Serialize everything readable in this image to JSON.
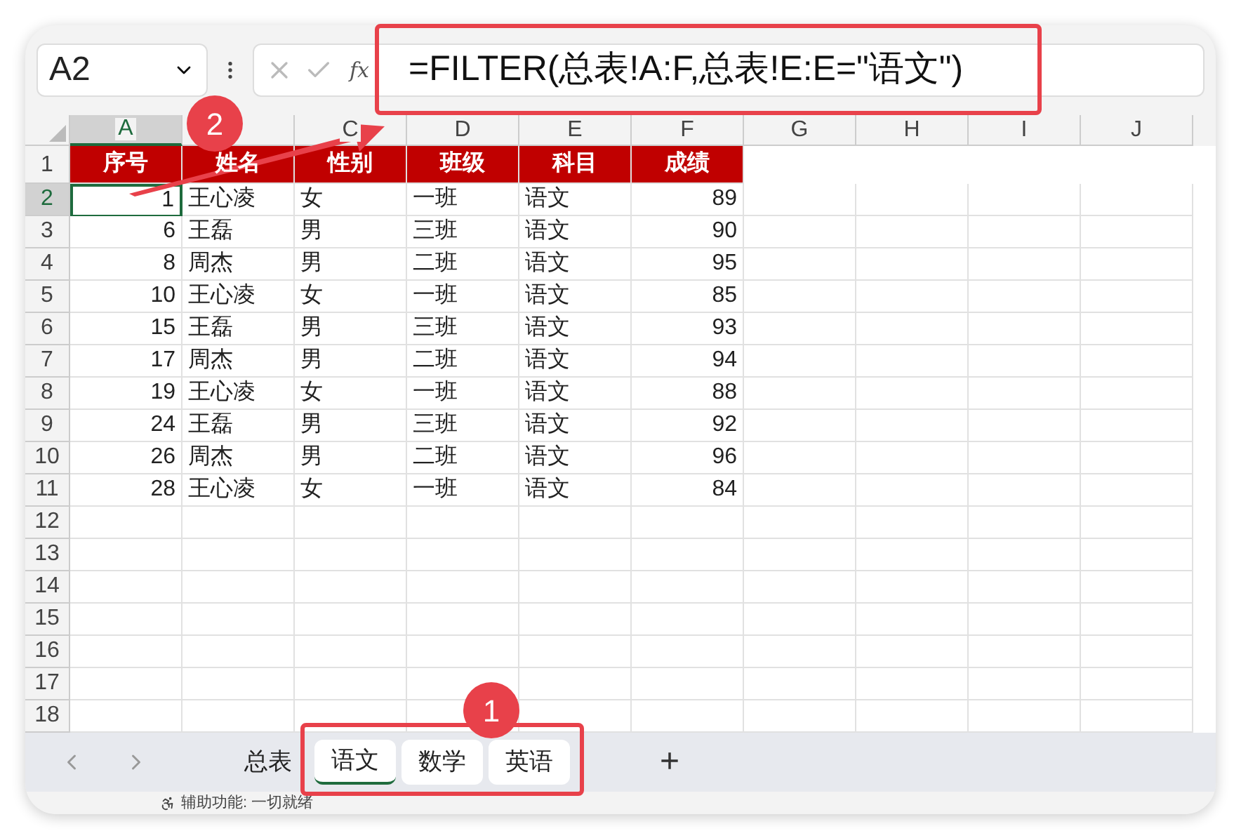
{
  "name_box": {
    "value": "A2"
  },
  "formula_bar": {
    "function_label": "fx",
    "value": "=FILTER(总表!A:F,总表!E:E=\"语文\")"
  },
  "columns": [
    {
      "label": "A",
      "selected": true
    },
    {
      "selected": false
    },
    {
      "label": "C",
      "selected": false
    },
    {
      "label": "D",
      "selected": false
    },
    {
      "label": "E",
      "selected": false
    },
    {
      "label": "F",
      "selected": false
    },
    {
      "label": "G",
      "selected": false
    },
    {
      "label": "H",
      "selected": false
    },
    {
      "label": "I",
      "selected": false
    },
    {
      "label": "J",
      "selected": false
    }
  ],
  "header_row": [
    "序号",
    "姓名",
    "性别",
    "班级",
    "科目",
    "成绩"
  ],
  "rows": [
    {
      "number": "2",
      "selected": true,
      "cells": [
        "1",
        "王心凌",
        "女",
        "一班",
        "语文",
        "89"
      ]
    },
    {
      "number": "3",
      "selected": false,
      "cells": [
        "6",
        "王磊",
        "男",
        "三班",
        "语文",
        "90"
      ]
    },
    {
      "number": "4",
      "selected": false,
      "cells": [
        "8",
        "周杰",
        "男",
        "二班",
        "语文",
        "95"
      ]
    },
    {
      "number": "5",
      "selected": false,
      "cells": [
        "10",
        "王心凌",
        "女",
        "一班",
        "语文",
        "85"
      ]
    },
    {
      "number": "6",
      "selected": false,
      "cells": [
        "15",
        "王磊",
        "男",
        "三班",
        "语文",
        "93"
      ]
    },
    {
      "number": "7",
      "selected": false,
      "cells": [
        "17",
        "周杰",
        "男",
        "二班",
        "语文",
        "94"
      ]
    },
    {
      "number": "8",
      "selected": false,
      "cells": [
        "19",
        "王心凌",
        "女",
        "一班",
        "语文",
        "88"
      ]
    },
    {
      "number": "9",
      "selected": false,
      "cells": [
        "24",
        "王磊",
        "男",
        "三班",
        "语文",
        "92"
      ]
    },
    {
      "number": "10",
      "selected": false,
      "cells": [
        "26",
        "周杰",
        "男",
        "二班",
        "语文",
        "96"
      ]
    },
    {
      "number": "11",
      "selected": false,
      "cells": [
        "28",
        "王心凌",
        "女",
        "一班",
        "语文",
        "84"
      ]
    }
  ],
  "empty_rows": [
    "12",
    "13",
    "14",
    "15",
    "16",
    "17",
    "18"
  ],
  "header_row_number": "1",
  "sheet_tabs": [
    {
      "label": "总表",
      "selected": false
    },
    {
      "label": "语文",
      "selected": true
    },
    {
      "label": "数学",
      "selected": false
    },
    {
      "label": "英语",
      "selected": false
    }
  ],
  "add_sheet": "+",
  "status_bar": {
    "accessibility": "辅助功能: 一切就绪"
  },
  "callouts": [
    "1",
    "2"
  ]
}
